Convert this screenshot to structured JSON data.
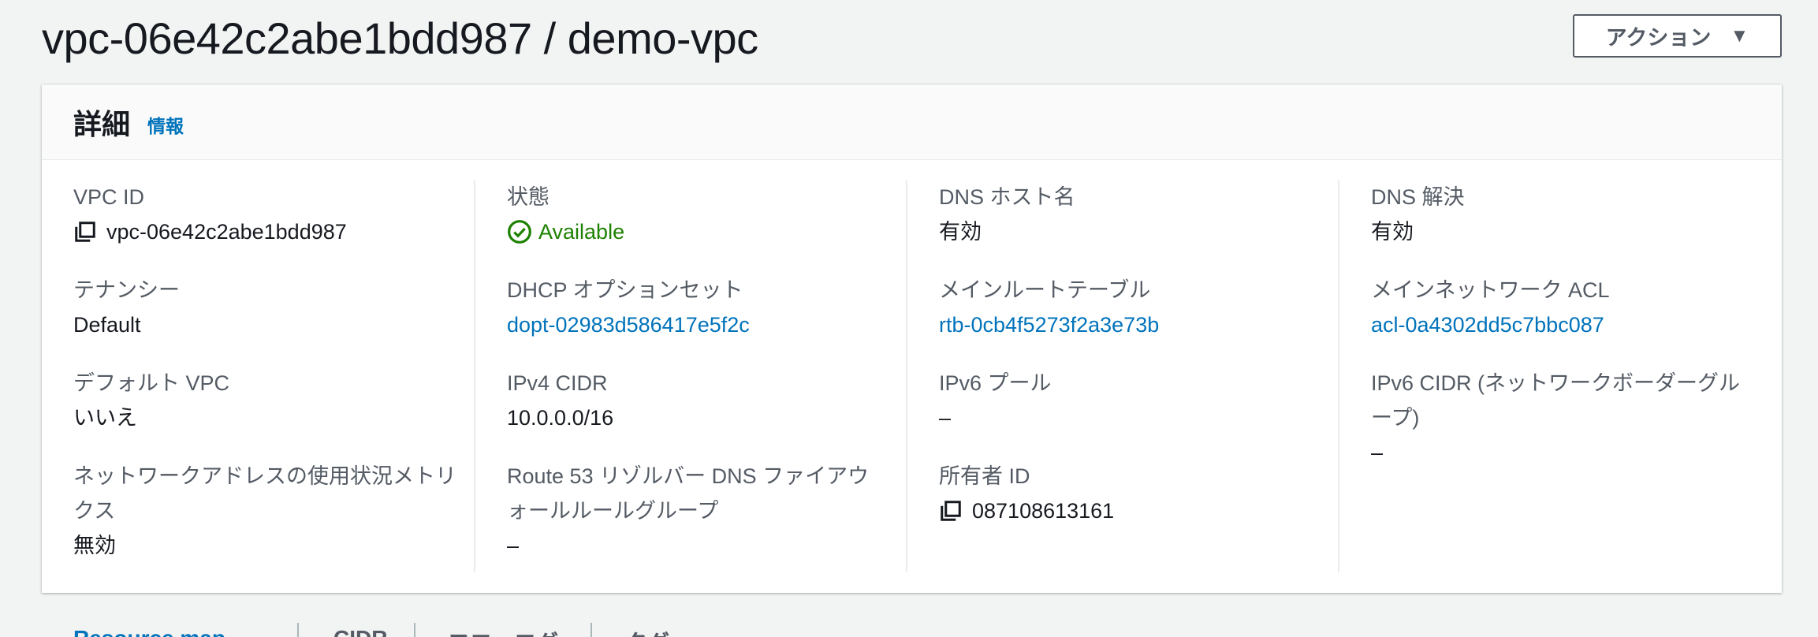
{
  "header": {
    "title": "vpc-06e42c2abe1bdd987 / demo-vpc",
    "action_label": "アクション"
  },
  "panel": {
    "title": "詳細",
    "info_label": "情報"
  },
  "fields": {
    "vpc_id": {
      "label": "VPC ID",
      "value": "vpc-06e42c2abe1bdd987"
    },
    "tenancy": {
      "label": "テナンシー",
      "value": "Default"
    },
    "default_vpc": {
      "label": "デフォルト VPC",
      "value": "いいえ"
    },
    "network_metrics": {
      "label": "ネットワークアドレスの使用状況メトリクス",
      "value": "無効"
    },
    "state": {
      "label": "状態",
      "value": "Available"
    },
    "dhcp": {
      "label": "DHCP オプションセット",
      "value": "dopt-02983d586417e5f2c"
    },
    "ipv4_cidr": {
      "label": "IPv4 CIDR",
      "value": "10.0.0.0/16"
    },
    "route53": {
      "label": "Route 53 リゾルバー DNS ファイアウォールルールグループ",
      "value": "–"
    },
    "dns_hostnames": {
      "label": "DNS ホスト名",
      "value": "有効"
    },
    "main_route_table": {
      "label": "メインルートテーブル",
      "value": "rtb-0cb4f5273f2a3e73b"
    },
    "ipv6_pool": {
      "label": "IPv6 プール",
      "value": "–"
    },
    "owner_id": {
      "label": "所有者 ID",
      "value": "087108613161"
    },
    "dns_resolution": {
      "label": "DNS 解決",
      "value": "有効"
    },
    "main_acl": {
      "label": "メインネットワーク ACL",
      "value": "acl-0a4302dd5c7bbc087"
    },
    "ipv6_cidr": {
      "label": "IPv6 CIDR (ネットワークボーダーグループ)",
      "value": "–"
    }
  },
  "tabs": [
    {
      "label": "Resource map"
    },
    {
      "label": "CIDR"
    },
    {
      "label": "フローログ"
    },
    {
      "label": "タグ"
    }
  ],
  "colors": {
    "link": "#0073bb",
    "available": "#1d8102",
    "text": "#16191f",
    "label": "#545b64"
  }
}
